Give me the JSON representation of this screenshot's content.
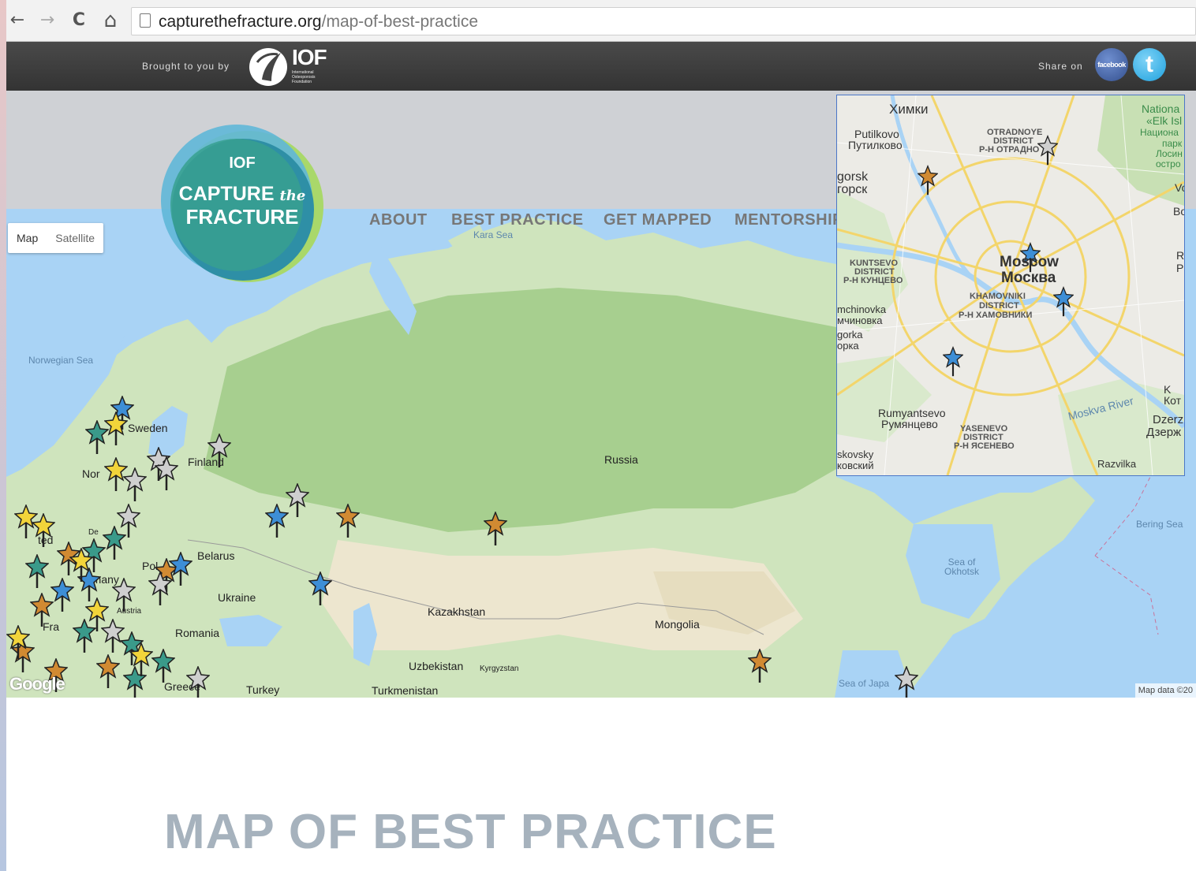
{
  "browser": {
    "url_domain": "capturethefracture.org",
    "url_path": "/map-of-best-practice",
    "back_icon": "←",
    "forward_icon": "→",
    "reload_icon": "C",
    "home_icon": "⌂"
  },
  "topbar": {
    "brought_by": "Brought to you by",
    "iof_name": "IOF",
    "iof_sub": "International Osteoporosis Foundation",
    "share_label": "Share on",
    "facebook_label": "facebook",
    "twitter_label": "t"
  },
  "logo": {
    "line1": "IOF",
    "line2": "CAPTURE",
    "line2b": "the",
    "line3": "FRACTURE"
  },
  "nav": {
    "about": "ABOUT",
    "best_practice": "BEST PRACTICE",
    "get_mapped": "GET MAPPED",
    "mentorship": "MENTORSHIP"
  },
  "map": {
    "toggle_map": "Map",
    "toggle_satellite": "Satellite",
    "credit": "Map data ©20",
    "google": "Google",
    "labels": {
      "kara_sea": "Kara Sea",
      "norwegian_sea": "Norwegian Sea",
      "sweden": "Sweden",
      "finland": "Finland",
      "norway": "Nor",
      "russia": "Russia",
      "belarus": "Belarus",
      "poland": "Pol",
      "ukraine": "Ukraine",
      "romania": "Romania",
      "austria": "Austria",
      "germany": "rmany",
      "france": "Fra",
      "united": "ted",
      "denmark": "De",
      "greece": "Greece",
      "turkey": "Turkey",
      "kazakhstan": "Kazakhstan",
      "uzbekistan": "Uzbekistan",
      "kyrgyzstan": "Kyrgyzstan",
      "turkmenistan": "Turkmenistan",
      "mongolia": "Mongolia",
      "sea_okhotsk": "Sea of Okhotsk",
      "bering_sea": "Bering Sea",
      "sea_japan": "Sea of Japa"
    },
    "marker_colors": {
      "orange": "#d18a32",
      "blue": "#3d8ed6",
      "teal": "#3a9a8a",
      "yellow": "#f2d43a",
      "grey": "#c8c8c8"
    }
  },
  "inset": {
    "khimki": "Химки",
    "putilkovo": "Putilkovo",
    "putilkovo_ru": "Путилково",
    "otradnoye1": "OTRADNOYE",
    "otradnoye2": "DISTRICT",
    "otradnoye3": "Р-Н ОТРАДНО",
    "gorsk": "gorsk",
    "gorsk_ru": "горск",
    "national1": "Nationa",
    "national2": "«Elk Isl",
    "national3": "Национа",
    "national4": "парк",
    "national5": "Лосин",
    "national6": "остро",
    "kuntsevo1": "KUNTSEVO",
    "kuntsevo2": "DISTRICT",
    "kuntsevo3": "Р-Н КУНЦЕВО",
    "moscow": "Moscow",
    "moscow_ru": "Москва",
    "khamovniki1": "KHAMOVNIKI",
    "khamovniki2": "DISTRICT",
    "khamovniki3": "Р-Н ХАМОВНИКИ",
    "mchinovka": "mchinovka",
    "mchinovka_ru": "мчиновка",
    "gorka": "gorka",
    "gorka_ru": "орка",
    "moskva_river": "Moskva River",
    "rumyantsevo": "Rumyantsevo",
    "rumyantsevo_ru": "Румянцево",
    "yasenevo1": "YASENEVO",
    "yasenevo2": "DISTRICT",
    "yasenevo3": "Р-Н ЯСЕНЕВО",
    "skovsky": "skovsky",
    "skovsky_ru": "ковский",
    "razvilka": "Razvilka",
    "dzerzh": "Dzerz",
    "dzerzh_ru": "Дзерж",
    "kot": "Кот",
    "k": "K",
    "vo": "Vo",
    "bo": "Bo",
    "r": "R",
    "p": "P"
  },
  "page": {
    "title": "MAP OF BEST PRACTICE"
  }
}
